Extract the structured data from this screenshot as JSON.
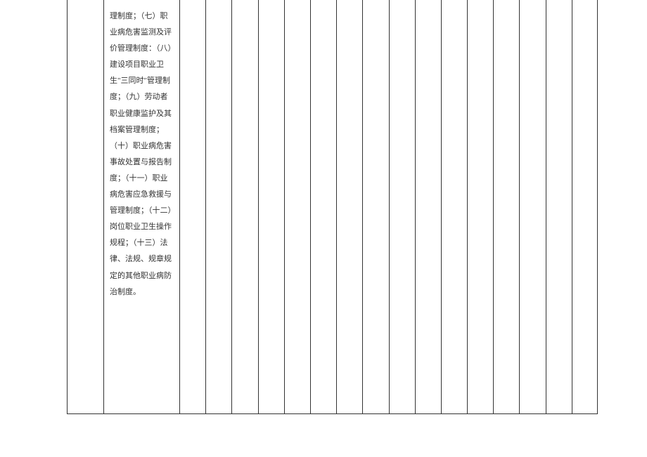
{
  "table": {
    "main_text": "理制度；（七）职业病危害监测及评价管理制度：（八）建设项目职业卫生\"三同时\"管理制度；（九）劳动者职业健康监护及其档案管理制度；（十）职业病危害事故处置与报告制度；（十一）职业病危害应急救援与管理制度；（十二）岗位职业卫生操作规程；（十三）法律、法规、规章规定的其他职业病防治制度。"
  }
}
